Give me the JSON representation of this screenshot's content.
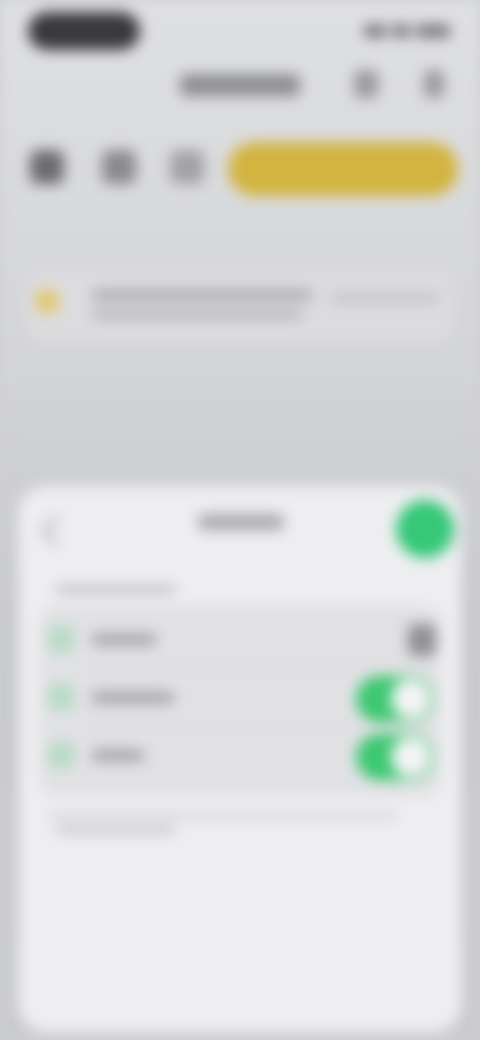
{
  "colors": {
    "accent_gold": "#d3b441",
    "accent_green": "#35c878",
    "background": "#cfd0d3",
    "sheet": "#eeeef0"
  },
  "icons": {
    "nav_right_1": "share-icon",
    "nav_right_2": "more-icon",
    "toolbar": [
      "grid-icon",
      "list-icon",
      "filter-icon"
    ],
    "banner": "warning-icon",
    "sheet_back": "chevron-left-icon",
    "sheet_done": "checkmark-icon",
    "row_lock": "lock-icon"
  },
  "settings": {
    "rows": [
      {
        "icon": "check-icon",
        "toggle": "locked"
      },
      {
        "icon": "check-icon",
        "toggle": "on"
      },
      {
        "icon": "check-icon",
        "toggle": "on"
      }
    ]
  }
}
